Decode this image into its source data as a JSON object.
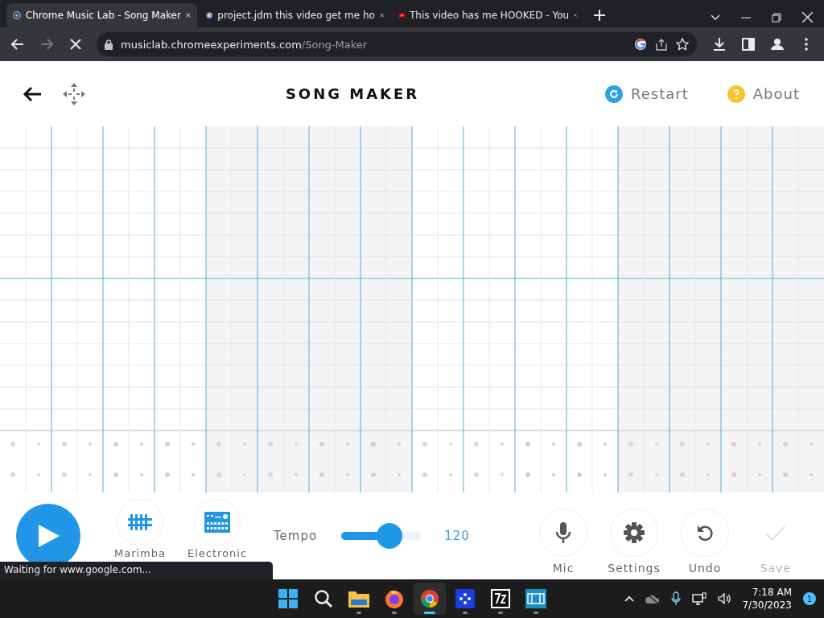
{
  "browser": {
    "tabs": [
      {
        "title": "Chrome Music Lab - Song Maker",
        "kind": "musiclab",
        "selected": true
      },
      {
        "title": "project.jdm this video get me ho",
        "kind": "google",
        "selected": false
      },
      {
        "title": "This video has me HOOKED - You",
        "kind": "youtube",
        "selected": false
      }
    ],
    "address": {
      "domain": "musiclab.chromeexperiments.com",
      "path": "/Song-Maker"
    },
    "status": "Waiting for www.google.com..."
  },
  "app": {
    "title": "SONG MAKER",
    "header_actions": [
      {
        "label": "Restart",
        "kind": "restart"
      },
      {
        "label": "About",
        "kind": "about"
      }
    ],
    "controls": [
      {
        "label": "Marimba",
        "kind": "marimba"
      },
      {
        "label": "Electronic",
        "kind": "electronic"
      }
    ],
    "tempo": {
      "label": "Tempo",
      "level": 0.6,
      "reading": "120"
    },
    "actions": [
      {
        "label": "Mic",
        "kind": "mic",
        "disabled": false
      },
      {
        "label": "Settings",
        "kind": "settings",
        "disabled": false
      },
      {
        "label": "Undo",
        "kind": "undo",
        "disabled": false
      },
      {
        "label": "Save",
        "kind": "save",
        "disabled": true
      }
    ]
  },
  "taskbar": {
    "apps": [
      {
        "kind": "start",
        "selected": false
      },
      {
        "kind": "search",
        "selected": false
      },
      {
        "kind": "files",
        "selected": false
      },
      {
        "kind": "firefox",
        "selected": false
      },
      {
        "kind": "chrome",
        "selected": true
      },
      {
        "kind": "dots",
        "selected": false
      },
      {
        "kind": "zip",
        "selected": false
      },
      {
        "kind": "film",
        "selected": false
      }
    ],
    "time": "7:18 AM",
    "date": "7/30/2023",
    "notifications": "1"
  }
}
